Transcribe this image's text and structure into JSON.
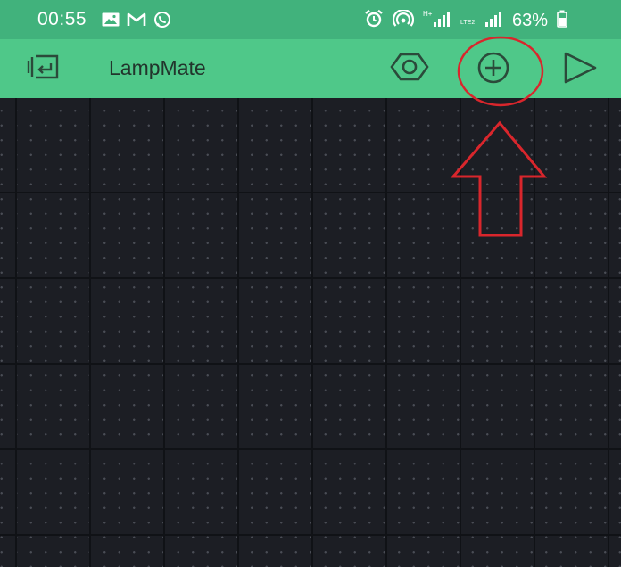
{
  "status_bar": {
    "time": "00:55",
    "battery": "63%",
    "left_icons": [
      "gallery-icon",
      "gmail-icon",
      "whatsapp-icon"
    ],
    "right_icons": [
      "alarm-icon",
      "hotspot-icon",
      "signal-h-plus-icon",
      "signal-volte-icon",
      "battery-icon"
    ],
    "network_label_1": "H+",
    "network_label_2": "LTE2"
  },
  "app_bar": {
    "title": "LampMate",
    "icons": [
      "back-to-projects-icon",
      "settings-hexagon-icon",
      "add-widget-icon",
      "play-icon"
    ],
    "color": "#4fc889"
  },
  "canvas": {
    "background": "#1c1e24"
  },
  "annotation": {
    "color": "#d9262c",
    "target": "add-widget-icon"
  }
}
